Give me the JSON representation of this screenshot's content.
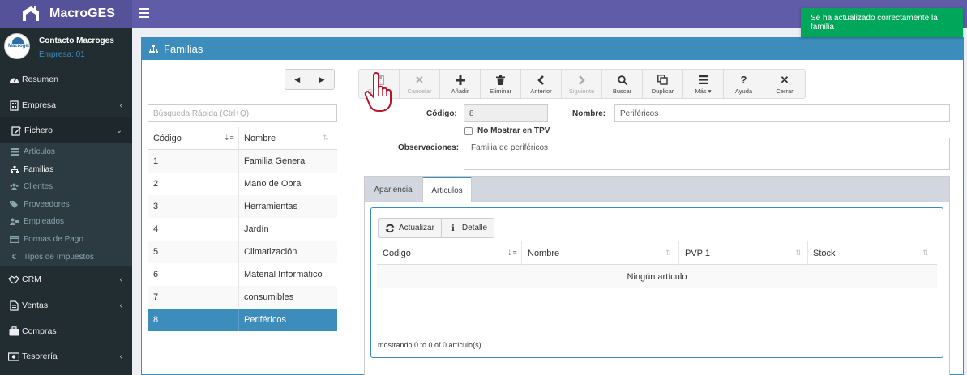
{
  "app": {
    "brand": "MacroGES",
    "user_name": "Contacto Macroges",
    "company": "Empresa: 01",
    "avatar_text": "Macroges"
  },
  "toast": {
    "message": "Se ha actualizado correctamente la familia",
    "color": "#00a65a"
  },
  "sidebar": {
    "items": [
      {
        "label": "Resumen",
        "icon": "dashboard-icon",
        "arrow": ""
      },
      {
        "label": "Empresa",
        "icon": "building-icon",
        "arrow": "‹"
      },
      {
        "label": "Fichero",
        "icon": "edit-icon",
        "arrow": "⌄"
      },
      {
        "label": "CRM",
        "icon": "handshake-icon",
        "arrow": "‹"
      },
      {
        "label": "Ventas",
        "icon": "document-icon",
        "arrow": "‹"
      },
      {
        "label": "Compras",
        "icon": "briefcase-icon",
        "arrow": ""
      },
      {
        "label": "Tesorería",
        "icon": "money-icon",
        "arrow": "‹"
      }
    ],
    "submenu": [
      {
        "label": "Artículos",
        "icon": "list-icon"
      },
      {
        "label": "Familias",
        "icon": "sitemap-icon"
      },
      {
        "label": "Clientes",
        "icon": "users-icon"
      },
      {
        "label": "Proveedores",
        "icon": "tags-icon"
      },
      {
        "label": "Empleados",
        "icon": "user-tie-icon"
      },
      {
        "label": "Formas de Pago",
        "icon": "credit-card-icon"
      },
      {
        "label": "Tipos de Impuestos",
        "icon": "euro-icon"
      }
    ]
  },
  "page": {
    "title": "Familias",
    "accent": "#3c8dbc"
  },
  "list": {
    "search_placeholder": "Búsqueda Rápida (Ctrl+Q)",
    "col_code": "Código",
    "col_name": "Nombre",
    "rows": [
      {
        "code": "1",
        "name": "Familia General"
      },
      {
        "code": "2",
        "name": "Mano de Obra"
      },
      {
        "code": "3",
        "name": "Herramientas"
      },
      {
        "code": "4",
        "name": "Jardín"
      },
      {
        "code": "5",
        "name": "Climatización"
      },
      {
        "code": "6",
        "name": "Material Informático"
      },
      {
        "code": "7",
        "name": "consumibles"
      },
      {
        "code": "8",
        "name": "Periféricos"
      }
    ]
  },
  "toolbar": {
    "buttons": [
      {
        "label": "Guardar",
        "icon": "save-icon",
        "disabled": true
      },
      {
        "label": "Cancelar",
        "icon": "cancel-icon",
        "disabled": true
      },
      {
        "label": "Añadir",
        "icon": "plus-icon",
        "disabled": false
      },
      {
        "label": "Eliminar",
        "icon": "trash-icon",
        "disabled": false
      },
      {
        "label": "Anterior",
        "icon": "chevron-left-icon",
        "disabled": false
      },
      {
        "label": "Siguiente",
        "icon": "chevron-right-icon",
        "disabled": true
      },
      {
        "label": "Buscar",
        "icon": "search-icon",
        "disabled": false
      },
      {
        "label": "Duplicar",
        "icon": "copy-icon",
        "disabled": false
      },
      {
        "label": "Más ▾",
        "icon": "menu-icon",
        "disabled": false
      },
      {
        "label": "Ayuda",
        "icon": "question-icon",
        "disabled": false
      },
      {
        "label": "Cerrar",
        "icon": "close-icon",
        "disabled": false
      }
    ]
  },
  "form": {
    "code_label": "Código:",
    "code_value": "8",
    "name_label": "Nombre:",
    "name_value": "Periféricos",
    "no_tpv_label": "No Mostrar en TPV",
    "obs_label": "Observaciones:",
    "obs_value": "Familia de periféricos"
  },
  "tabs": {
    "items": [
      "Apariencia",
      "Articulos"
    ],
    "active": "Articulos"
  },
  "articles": {
    "refresh_label": "Actualizar",
    "detail_label": "Detalle",
    "columns": [
      "Codigo",
      "Nombre",
      "PVP 1",
      "Stock"
    ],
    "empty": "Ningún artículo",
    "info": "mostrando 0 to 0 of 0 artículo(s)"
  }
}
